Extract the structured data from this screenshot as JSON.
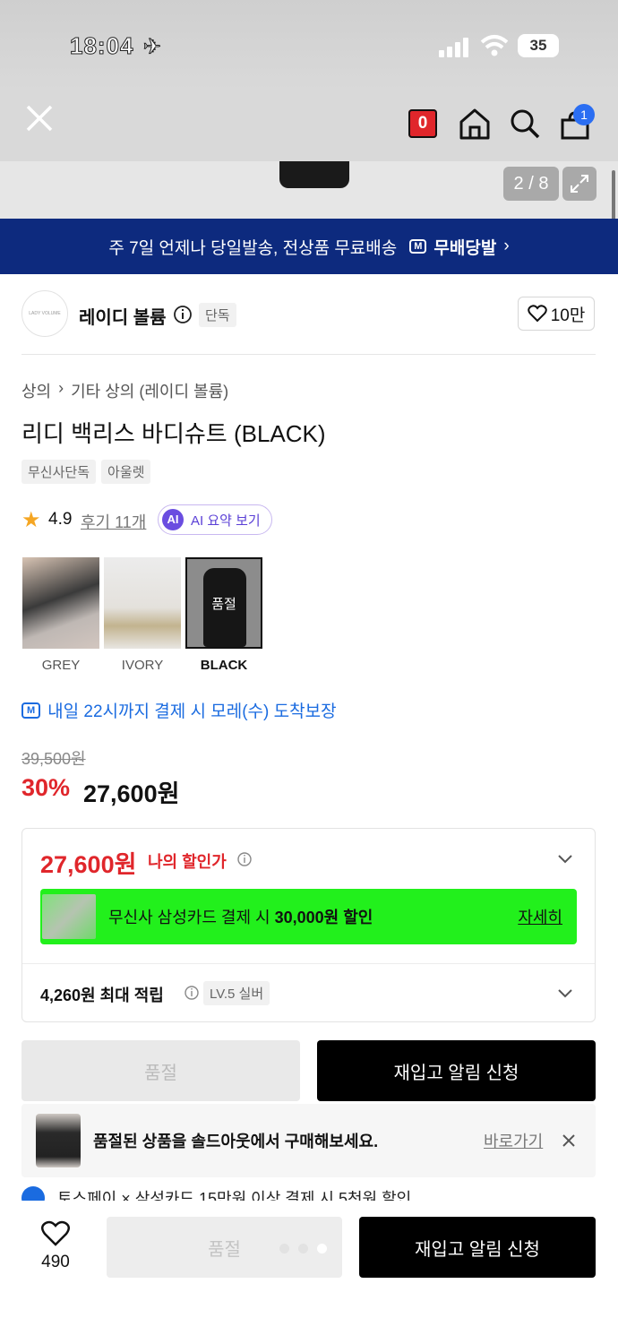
{
  "status": {
    "time": "18:04",
    "battery": "35"
  },
  "nav": {
    "cart_badge": "1",
    "red_badge": "0"
  },
  "gallery": {
    "counter": "2 / 8"
  },
  "banner": {
    "text": "주 7일 언제나 당일발송, 전상품 무료배송",
    "brand": "무배당발"
  },
  "seller": {
    "logo_text": "LADY VOLUME",
    "name": "레이디 볼륨",
    "tag": "단독",
    "likes": "10만"
  },
  "breadcrumb": {
    "cat1": "상의",
    "cat2": "기타 상의 (레이디 볼륨)"
  },
  "product": {
    "title": "리디 백리스 바디슈트 (BLACK)",
    "chips": [
      "무신사단독",
      "아울렛"
    ],
    "rating": "4.9",
    "reviews": "후기 11개",
    "ai_label": "AI 요약 보기"
  },
  "colors": [
    {
      "name": "GREY",
      "soldout": ""
    },
    {
      "name": "IVORY",
      "soldout": ""
    },
    {
      "name": "BLACK",
      "soldout": "품절"
    }
  ],
  "delivery": "내일 22시까지 결제 시 모레(수) 도착보장",
  "price": {
    "original": "39,500원",
    "discount": "30%",
    "sale": "27,600원"
  },
  "benefit": {
    "my_price": "27,600원",
    "my_price_label": "나의 할인가",
    "card_text_pre": "무신사 삼성카드 결제 시 ",
    "card_amount": "30,000원 할인",
    "card_detail": "자세히",
    "points": "4,260원 최대 적립",
    "level": "LV.5 실버"
  },
  "actions": {
    "soldout": "품절",
    "restock": "재입고 알림 신청"
  },
  "toast": {
    "text": "품절된 상품을 솔드아웃에서 구매해보세요.",
    "link": "바로가기"
  },
  "promo": "토스페이 × 삼성카드 15만원 이상 결제 시 5천원 할인",
  "bottom": {
    "likes": "490",
    "soldout": "품절",
    "restock": "재입고 알림 신청"
  },
  "colors_theme": {
    "navy": "#0d2a7e",
    "red": "#e0262b",
    "green": "#22f01c",
    "blue": "#1a6be0"
  }
}
